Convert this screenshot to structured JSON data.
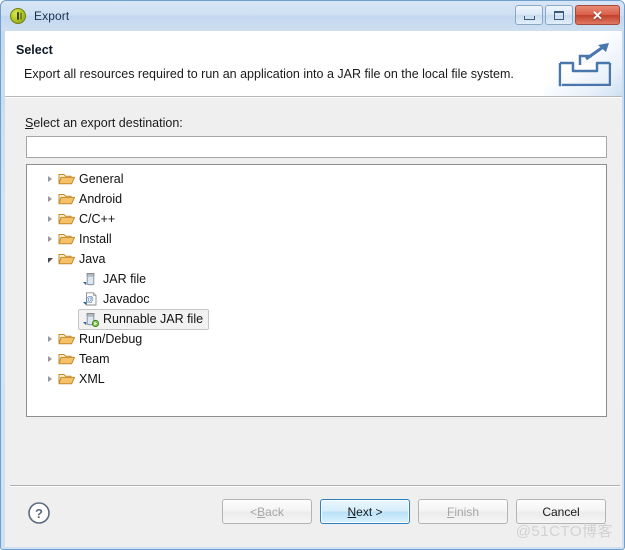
{
  "window": {
    "title": "Export",
    "app_icon": "eclipse-icon",
    "controls": {
      "minimize": "minimize-icon",
      "maximize": "maximize-icon",
      "close": "✕"
    }
  },
  "header": {
    "title": "Select",
    "description": "Export all resources required to run an application into a JAR file on the local file system.",
    "banner_icon": "export-wizard-icon"
  },
  "main": {
    "destination_label_accel": "S",
    "destination_label_rest": "elect an export destination:",
    "filter": {
      "value": "",
      "placeholder": ""
    },
    "tree": [
      {
        "label": "General",
        "level": 0,
        "icon": "folder-icon",
        "state": "collapsed",
        "selected": false
      },
      {
        "label": "Android",
        "level": 0,
        "icon": "folder-icon",
        "state": "collapsed",
        "selected": false
      },
      {
        "label": "C/C++",
        "level": 0,
        "icon": "folder-icon",
        "state": "collapsed",
        "selected": false
      },
      {
        "label": "Install",
        "level": 0,
        "icon": "folder-icon",
        "state": "collapsed",
        "selected": false
      },
      {
        "label": "Java",
        "level": 0,
        "icon": "folder-icon",
        "state": "expanded",
        "selected": false
      },
      {
        "label": "JAR file",
        "level": 1,
        "icon": "jar-file-icon",
        "state": "leaf",
        "selected": false
      },
      {
        "label": "Javadoc",
        "level": 1,
        "icon": "javadoc-icon",
        "state": "leaf",
        "selected": false
      },
      {
        "label": "Runnable JAR file",
        "level": 1,
        "icon": "runnable-jar-icon",
        "state": "leaf",
        "selected": true
      },
      {
        "label": "Run/Debug",
        "level": 0,
        "icon": "folder-icon",
        "state": "collapsed",
        "selected": false
      },
      {
        "label": "Team",
        "level": 0,
        "icon": "folder-icon",
        "state": "collapsed",
        "selected": false
      },
      {
        "label": "XML",
        "level": 0,
        "icon": "folder-icon",
        "state": "collapsed",
        "selected": false
      }
    ]
  },
  "footer": {
    "help_icon": "help-question-icon",
    "buttons": [
      {
        "id": "back",
        "prefix": "< ",
        "accel": "B",
        "suffix": "ack",
        "state": "disabled",
        "default": false
      },
      {
        "id": "next",
        "prefix": "",
        "accel": "N",
        "suffix": "ext >",
        "state": "enabled",
        "default": true
      },
      {
        "id": "finish",
        "prefix": "",
        "accel": "F",
        "suffix": "inish",
        "state": "disabled",
        "default": false
      },
      {
        "id": "cancel",
        "prefix": "",
        "accel": "",
        "suffix": "Cancel",
        "state": "enabled",
        "default": false
      }
    ]
  },
  "watermark": "@51CTO博客",
  "colors": {
    "window_frame": "#6e9fcd",
    "titlebar": "#cfe0f2",
    "close_button": "#c1412c",
    "content_background": "#efefef",
    "panel_background": "#ffffff",
    "default_button_border": "#2f7fbf",
    "folder_icon": "#f0b95a"
  }
}
